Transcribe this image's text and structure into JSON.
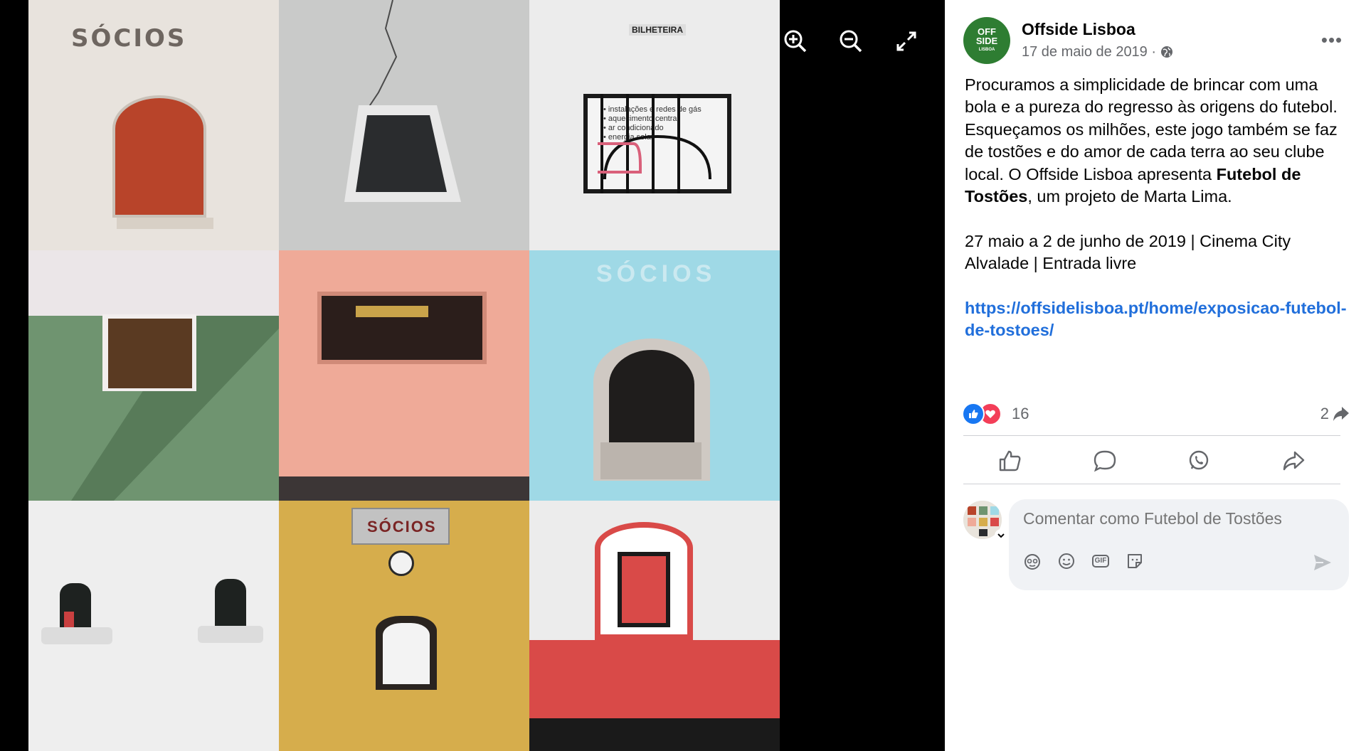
{
  "viewer": {
    "tools": [
      "zoom-in-icon",
      "zoom-out-icon",
      "fullscreen-icon"
    ],
    "tile_texts": {
      "socios_top": "SÓCIOS",
      "bilheteira": "BILHETEIRA",
      "poster_lines": [
        "• instalações e redes de gás",
        "• aquecimento central",
        "• ar condicionado",
        "• energia solar"
      ],
      "socios_faded": "SÓCIOS",
      "socios_sign": "SÓCIOS"
    }
  },
  "post": {
    "page_name": "Offside Lisboa",
    "avatar_text": [
      "OFF",
      "SIDE",
      "LISBOA"
    ],
    "date": "17 de maio de 2019",
    "date_separator": "·",
    "more_label": "•••",
    "body": {
      "p1_a": "Procuramos a simplicidade de brincar com uma bola e a pureza do regresso às origens do futebol. Esqueçamos os milhões, este jogo também se faz de tostões e do amor de cada terra ao seu clube local. O Offside Lisboa apresenta ",
      "p1_bold": "Futebol de Tostões",
      "p1_b": ", um projeto de Marta Lima.",
      "p2": "27 maio a 2 de junho de 2019 | Cinema City Alvalade | Entrada livre",
      "link": "https://offsidelisboa.pt/home/exposicao-futebol-de-tostoes/"
    },
    "reaction_count": "16",
    "share_count": "2",
    "colors": {
      "like": "#1877f2",
      "love": "#f33e58",
      "link": "#216fdb",
      "avatar": "#2e7d32"
    }
  },
  "comment": {
    "placeholder": "Comentar como Futebol de Tostões",
    "tools": [
      "avatar-sticker-icon",
      "emoji-icon",
      "gif-icon",
      "sticker-icon"
    ],
    "gif_label": "GIF"
  }
}
